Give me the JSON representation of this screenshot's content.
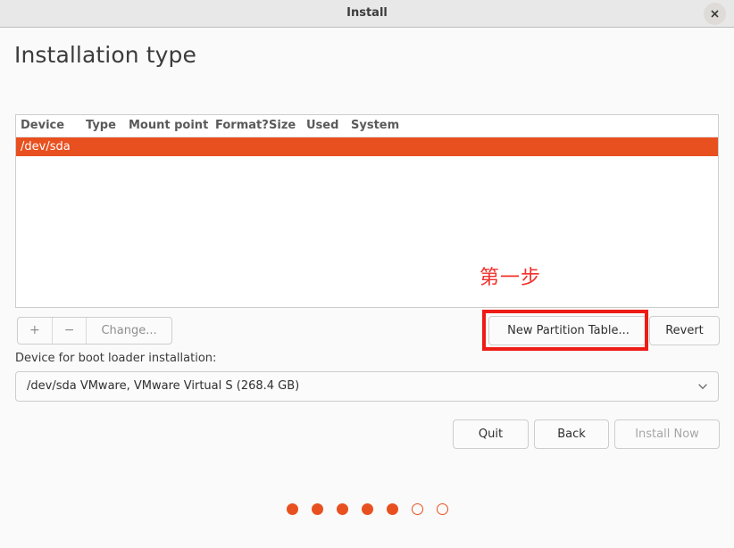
{
  "window": {
    "title": "Install",
    "close_icon": "close-icon"
  },
  "page": {
    "heading": "Installation type"
  },
  "partition_table": {
    "columns": [
      "Device",
      "Type",
      "Mount point",
      "Format?",
      "Size",
      "Used",
      "System"
    ],
    "rows": [
      {
        "device": "/dev/sda",
        "type": "",
        "mount_point": "",
        "format": "",
        "size": "",
        "used": "",
        "system": "",
        "selected": true
      }
    ]
  },
  "edit_buttons": {
    "add_label": "+",
    "remove_label": "−",
    "change_label": "Change..."
  },
  "table_actions": {
    "new_partition_table_label": "New Partition Table...",
    "revert_label": "Revert"
  },
  "annotation": {
    "text": "第一步",
    "color": "#f3302a",
    "box_color": "#ee1c16"
  },
  "bootloader": {
    "label": "Device for boot loader installation:",
    "selected": "/dev/sda VMware, VMware Virtual S (268.4 GB)",
    "chevron_icon": "chevron-down-icon"
  },
  "footer": {
    "quit_label": "Quit",
    "back_label": "Back",
    "install_now_label": "Install Now"
  },
  "progress": {
    "total": 7,
    "completed": 5,
    "dots": [
      "filled",
      "filled",
      "filled",
      "filled",
      "filled",
      "hollow",
      "hollow"
    ]
  },
  "colors": {
    "accent": "#e8501f",
    "titlebar": "#e8e8e8",
    "background": "#fafafa"
  }
}
